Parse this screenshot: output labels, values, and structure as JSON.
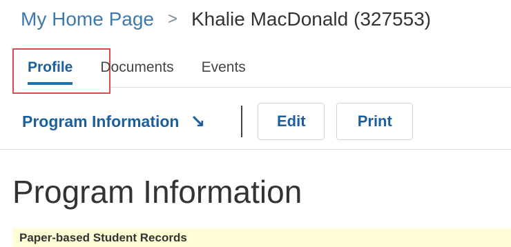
{
  "breadcrumb": {
    "home": "My Home Page",
    "separator": ">",
    "current": "Khalie MacDonald (327553)"
  },
  "tabs": [
    {
      "label": "Profile",
      "active": true
    },
    {
      "label": "Documents",
      "active": false
    },
    {
      "label": "Events",
      "active": false
    }
  ],
  "toolbar": {
    "program_link": "Program Information",
    "program_arrow_icon": "arrow-down-right-icon",
    "edit_label": "Edit",
    "print_label": "Print"
  },
  "page": {
    "title": "Program Information",
    "notice": "Paper-based Student Records"
  },
  "colors": {
    "link": "#3d79ad",
    "accent": "#1d5f9c",
    "highlight_border": "#e0484c",
    "notice_bg": "#fefdd5"
  }
}
